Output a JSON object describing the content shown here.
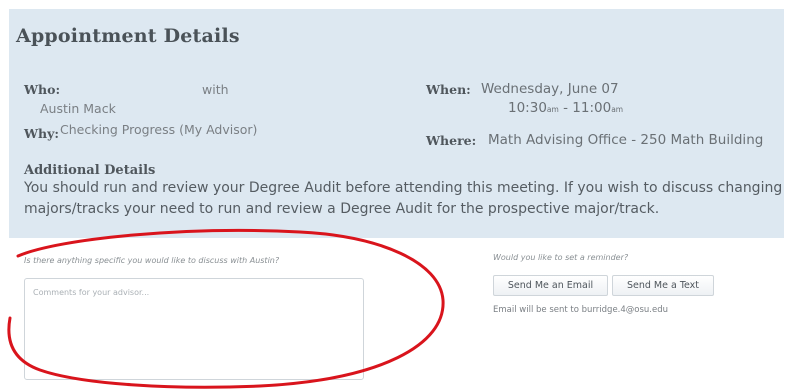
{
  "details": {
    "title": "Appointment Details",
    "who_label": "Who:",
    "with_text": "with",
    "advisor_name": "Austin Mack",
    "why_label": "Why:",
    "why_value": "Checking Progress (My Advisor)",
    "when_label": "When:",
    "when_date": "Wednesday, June 07",
    "time_start": "10:30",
    "time_start_suffix": "am",
    "time_sep": " - ",
    "time_end": "11:00",
    "time_end_suffix": "am",
    "where_label": "Where:",
    "where_value": "Math Advising Office - 250 Math Building",
    "additional_heading": "Additional Details",
    "additional_text": "You should run and review your Degree Audit before attending this meeting. If you wish to discuss changing majors/tracks your need to run and review a Degree Audit for the prospective major/track."
  },
  "comments": {
    "question": "Is there anything specific you would like to discuss with Austin?",
    "placeholder": "Comments for your advisor..."
  },
  "reminder": {
    "question": "Would you like to set a reminder?",
    "email_button": "Send Me an Email",
    "text_button": "Send Me a Text",
    "email_note": "Email will be sent to burridge.4@osu.edu"
  },
  "colors": {
    "panel_bg": "#dde8f1",
    "annotation_red": "#d9141c"
  }
}
